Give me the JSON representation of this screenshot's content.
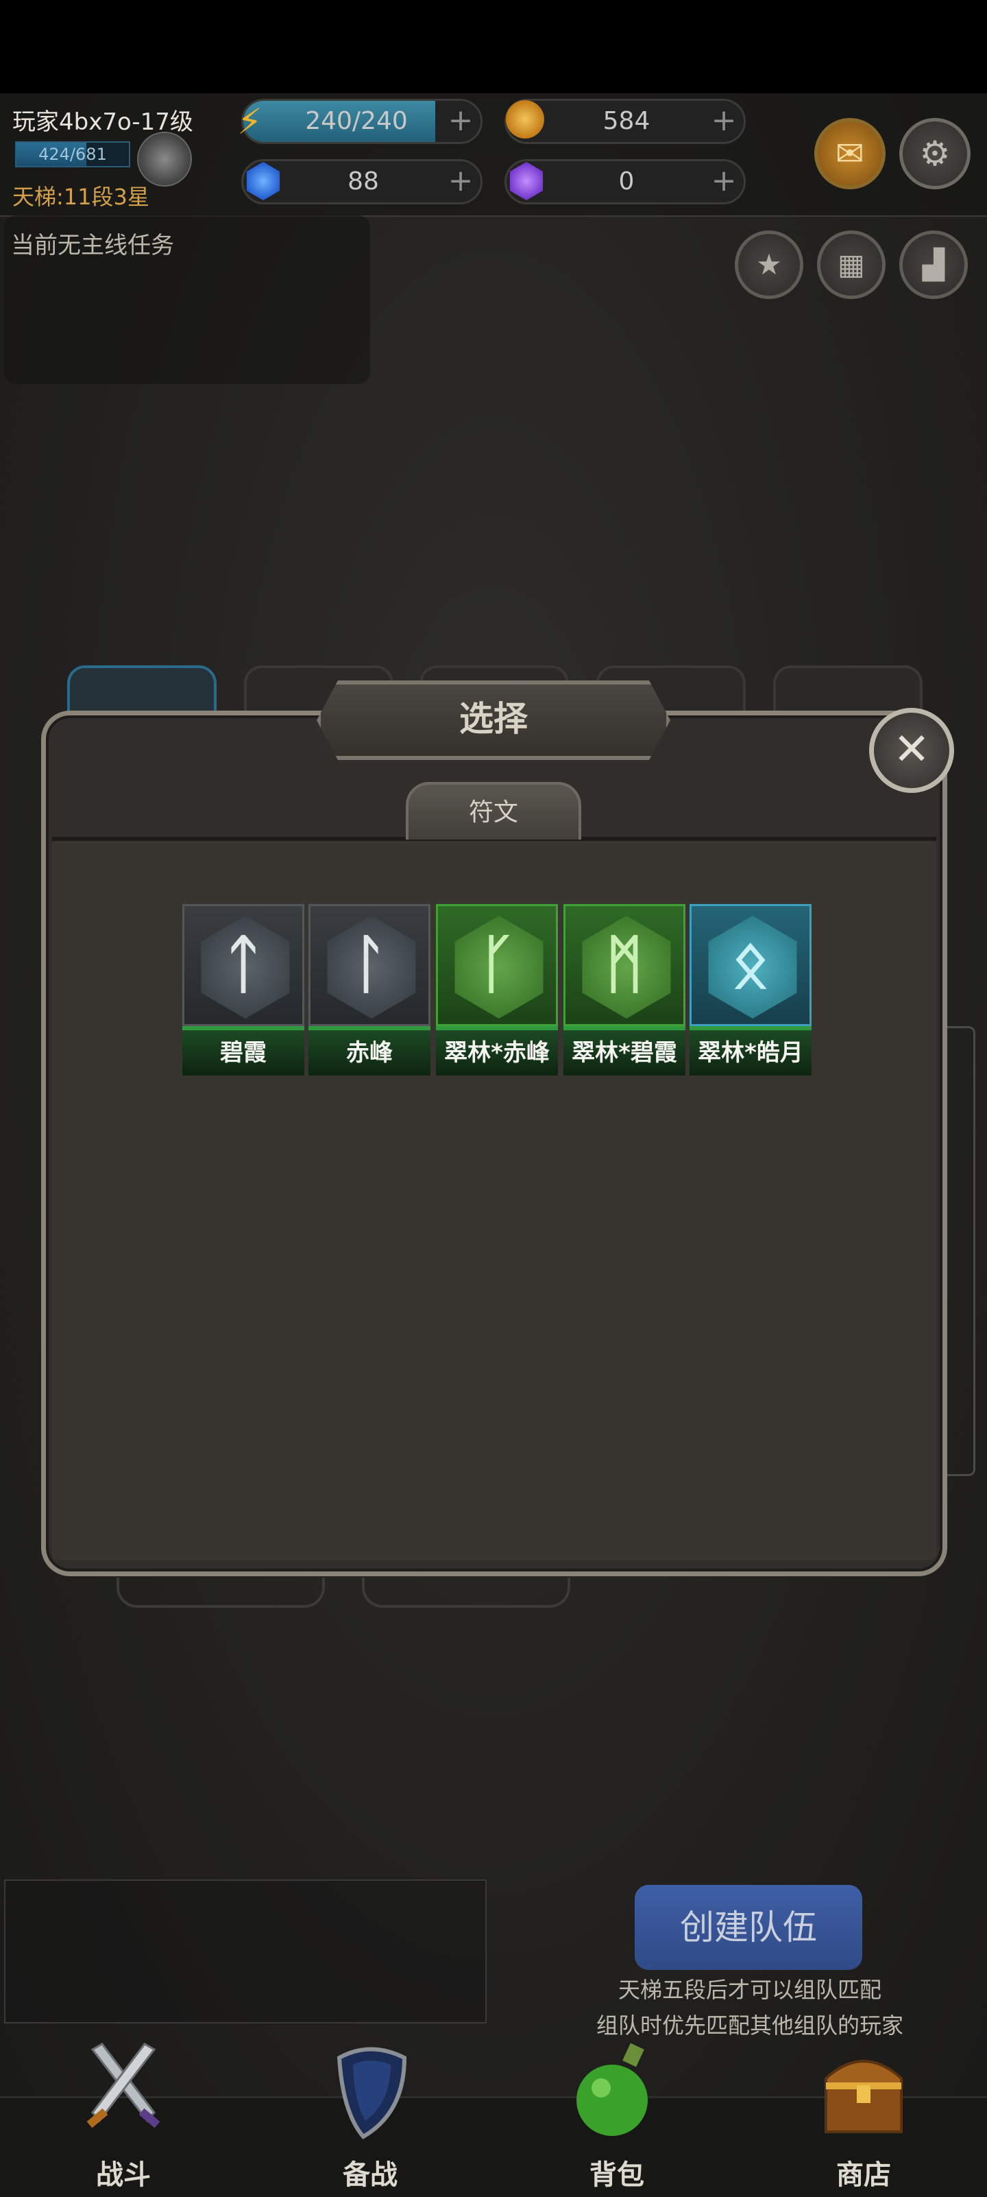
{
  "player": {
    "name_level": "玩家4bx7o-17级",
    "exp_text": "424/681",
    "exp_fraction": 0.62,
    "ladder": "天梯:11段3星"
  },
  "resources": {
    "energy": "240/240",
    "energy_fraction": 1.0,
    "gold": "584",
    "blue_gem": "88",
    "purple_gem": "0",
    "plus": "+"
  },
  "quest": {
    "text": "当前无主线任务"
  },
  "modal": {
    "title": "选择",
    "tab": "符文",
    "runes": [
      {
        "name": "碧霞",
        "glyph": "ᛏ",
        "rarity": "gray"
      },
      {
        "name": "赤峰",
        "glyph": "ᛚ",
        "rarity": "gray"
      },
      {
        "name": "翠林*赤峰",
        "glyph": "ᚴ",
        "rarity": "green"
      },
      {
        "name": "翠林*碧霞",
        "glyph": "ᛗ",
        "rarity": "green"
      },
      {
        "name": "翠林*皓月",
        "glyph": "ᛟ",
        "rarity": "teal"
      }
    ]
  },
  "team": {
    "create_label": "创建队伍",
    "tip1": "天梯五段后才可以组队匹配",
    "tip2": "组队时优先匹配其他组队的玩家"
  },
  "nav": {
    "battle": "战斗",
    "prepare": "备战",
    "bag": "背包",
    "shop": "商店"
  },
  "colors": {
    "accent_blue": "#2f4a86",
    "gold_text": "#d4a14a",
    "rune_green": "#2f9a3e"
  }
}
